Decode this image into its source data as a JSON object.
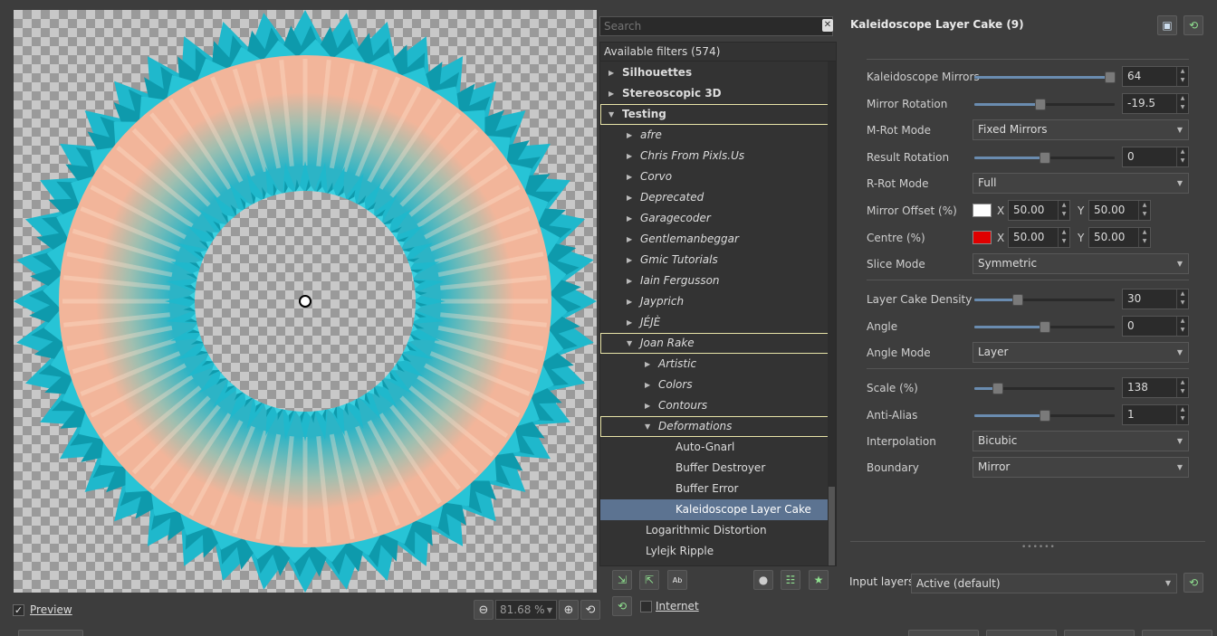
{
  "preview": {
    "preview_label": "Preview",
    "zoom_value": "81.68 %"
  },
  "search": {
    "placeholder": "Search"
  },
  "tree": {
    "header": "Available filters (574)",
    "items": [
      {
        "label": "Silhouettes",
        "arrow": "right"
      },
      {
        "label": "Stereoscopic 3D",
        "arrow": "right"
      },
      {
        "label": "Testing",
        "arrow": "down"
      },
      {
        "label": "afre",
        "arrow": "right"
      },
      {
        "label": "Chris From Pixls.Us",
        "arrow": "right"
      },
      {
        "label": "Corvo",
        "arrow": "right"
      },
      {
        "label": "Deprecated",
        "arrow": "right"
      },
      {
        "label": "Garagecoder",
        "arrow": "right"
      },
      {
        "label": "Gentlemanbeggar",
        "arrow": "right"
      },
      {
        "label": "Gmic Tutorials",
        "arrow": "right"
      },
      {
        "label": "Iain Fergusson",
        "arrow": "right"
      },
      {
        "label": "Jayprich",
        "arrow": "right"
      },
      {
        "label": "JÉJÈ",
        "arrow": "right"
      },
      {
        "label": "Joan Rake",
        "arrow": "down"
      },
      {
        "label": "Artistic",
        "arrow": "right"
      },
      {
        "label": "Colors",
        "arrow": "right"
      },
      {
        "label": "Contours",
        "arrow": "right"
      },
      {
        "label": "Deformations",
        "arrow": "down"
      },
      {
        "label": "Auto-Gnarl"
      },
      {
        "label": "Buffer Destroyer"
      },
      {
        "label": "Buffer Error"
      },
      {
        "label": "Kaleidoscope Layer Cake"
      },
      {
        "label": "Logarithmic Distortion"
      },
      {
        "label": "Lylejk Ripple"
      }
    ]
  },
  "tree_toolbar": {
    "internet_label": "Internet"
  },
  "panel": {
    "title": "Kaleidoscope Layer Cake (9)",
    "params": {
      "kaleidoscope_mirrors": {
        "label": "Kaleidoscope Mirrors",
        "value": "64",
        "level": 0.97
      },
      "mirror_rotation": {
        "label": "Mirror Rotation",
        "value": "-19.5",
        "level": 0.47
      },
      "mrot_mode": {
        "label": "M-Rot Mode",
        "value": "Fixed Mirrors"
      },
      "result_rotation": {
        "label": "Result Rotation",
        "value": "0",
        "level": 0.5
      },
      "rrot_mode": {
        "label": "R-Rot Mode",
        "value": "Full"
      },
      "mirror_offset": {
        "label": "Mirror Offset (%)",
        "color": "#ffffff",
        "x_label": "X",
        "x": "50.00",
        "y_label": "Y",
        "y": "50.00"
      },
      "centre": {
        "label": "Centre (%)",
        "color": "#e00000",
        "x_label": "X",
        "x": "50.00",
        "y_label": "Y",
        "y": "50.00"
      },
      "slice_mode": {
        "label": "Slice Mode",
        "value": "Symmetric"
      },
      "layer_cake_density": {
        "label": "Layer Cake Density",
        "value": "30",
        "level": 0.31
      },
      "angle": {
        "label": "Angle",
        "value": "0",
        "level": 0.5
      },
      "angle_mode": {
        "label": "Angle Mode",
        "value": "Layer"
      },
      "scale": {
        "label": "Scale (%)",
        "value": "138",
        "level": 0.17
      },
      "anti_alias": {
        "label": "Anti-Alias",
        "value": "1",
        "level": 0.5
      },
      "interpolation": {
        "label": "Interpolation",
        "value": "Bicubic"
      },
      "boundary": {
        "label": "Boundary",
        "value": "Mirror"
      }
    }
  },
  "input_layers": {
    "label": "Input layers",
    "value": "Active (default)"
  },
  "colors": {
    "accent": "#5c7391",
    "highlight_border": "#e8e4a8",
    "ring_cyan": "#1fb8cc",
    "ring_peach": "#f2b59a"
  }
}
